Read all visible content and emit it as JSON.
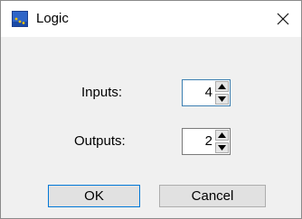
{
  "window": {
    "title": "Logic",
    "title_icon": "app-icon",
    "close_icon": "close-icon"
  },
  "fields": {
    "inputs": {
      "label": "Inputs:",
      "value": "4"
    },
    "outputs": {
      "label": "Outputs:",
      "value": "2"
    }
  },
  "buttons": {
    "ok": "OK",
    "cancel": "Cancel"
  },
  "colors": {
    "dialog_bg": "#f0f0f0",
    "titlebar_bg": "#ffffff",
    "focus_border": "#3c7fb1",
    "default_button_border": "#0078d7"
  }
}
